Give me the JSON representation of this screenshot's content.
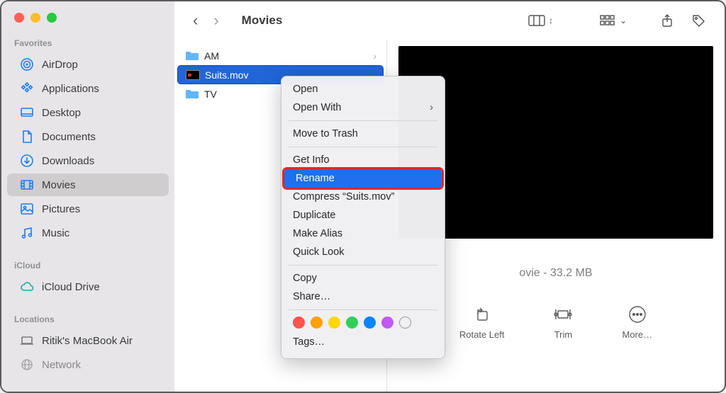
{
  "window_title": "Movies",
  "sidebar": {
    "sections": [
      {
        "label": "Favorites",
        "items": [
          {
            "label": "AirDrop",
            "icon": "airdrop"
          },
          {
            "label": "Applications",
            "icon": "apps"
          },
          {
            "label": "Desktop",
            "icon": "desktop"
          },
          {
            "label": "Documents",
            "icon": "documents"
          },
          {
            "label": "Downloads",
            "icon": "downloads"
          },
          {
            "label": "Movies",
            "icon": "movies",
            "selected": true
          },
          {
            "label": "Pictures",
            "icon": "pictures"
          },
          {
            "label": "Music",
            "icon": "music"
          }
        ]
      },
      {
        "label": "iCloud",
        "items": [
          {
            "label": "iCloud Drive",
            "icon": "icloud"
          }
        ]
      },
      {
        "label": "Locations",
        "items": [
          {
            "label": "Ritik's MacBook Air",
            "icon": "laptop"
          },
          {
            "label": "Network",
            "icon": "network"
          }
        ]
      }
    ]
  },
  "files": [
    {
      "name": "AM",
      "type": "folder"
    },
    {
      "name": "Suits.mov",
      "type": "video",
      "selected": true
    },
    {
      "name": "TV",
      "type": "folder"
    }
  ],
  "preview": {
    "info_suffix": "ovie - 33.2 MB",
    "actions": [
      {
        "label": "Rotate Left",
        "icon": "rotate"
      },
      {
        "label": "Trim",
        "icon": "trim"
      },
      {
        "label": "More…",
        "icon": "more"
      }
    ]
  },
  "context_menu": {
    "groups": [
      [
        {
          "label": "Open"
        },
        {
          "label": "Open With",
          "submenu": true
        }
      ],
      [
        {
          "label": "Move to Trash"
        }
      ],
      [
        {
          "label": "Get Info"
        },
        {
          "label": "Rename",
          "highlight": true
        },
        {
          "label": "Compress “Suits.mov”"
        },
        {
          "label": "Duplicate"
        },
        {
          "label": "Make Alias"
        },
        {
          "label": "Quick Look"
        }
      ],
      [
        {
          "label": "Copy"
        },
        {
          "label": "Share…"
        }
      ]
    ],
    "tag_colors": [
      "#ff534f",
      "#ff9f0a",
      "#ffd60a",
      "#30d158",
      "#0a84ff",
      "#bf5af2",
      "transparent"
    ],
    "tags_label": "Tags…"
  }
}
